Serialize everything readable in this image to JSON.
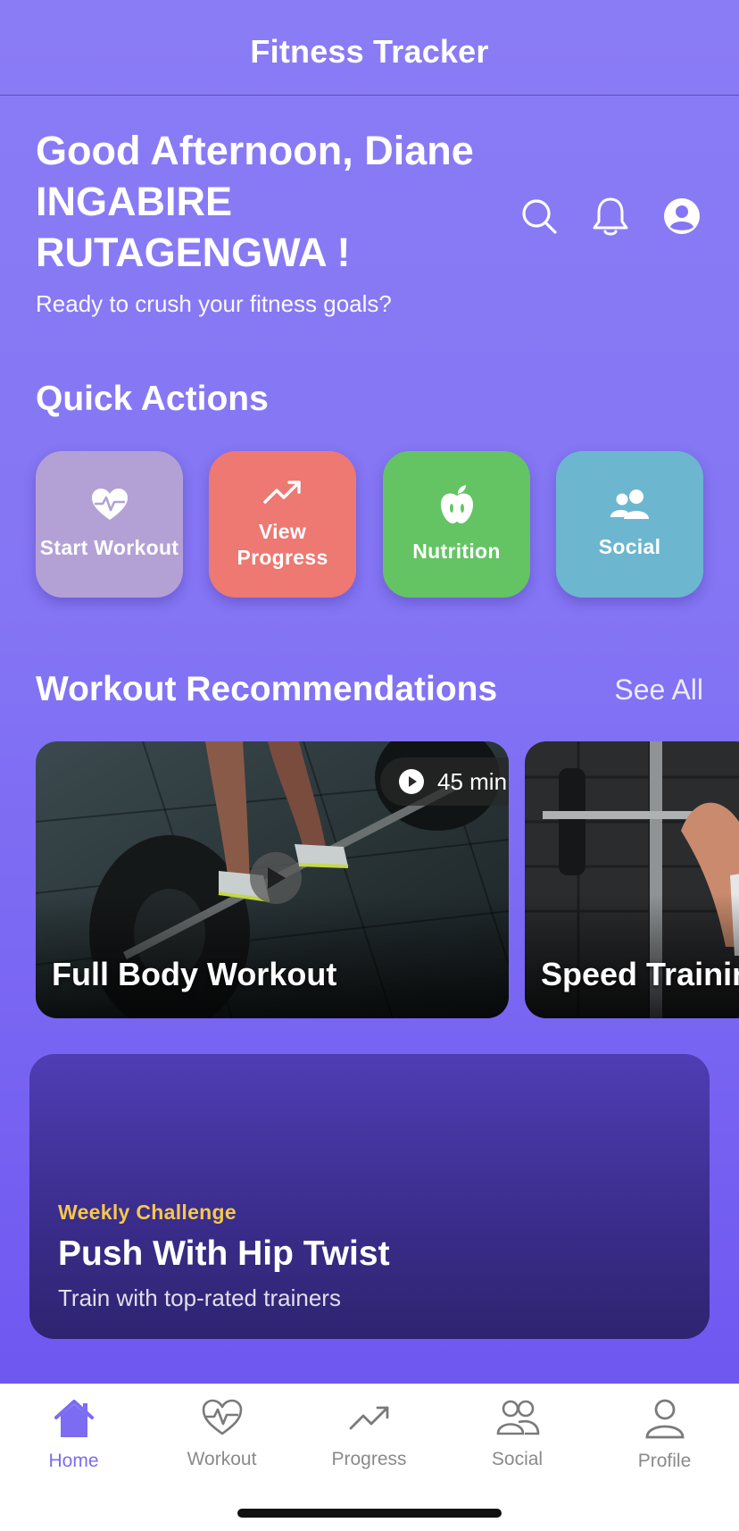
{
  "header": {
    "title": "Fitness Tracker"
  },
  "greeting": {
    "title": "Good Afternoon, Diane INGABIRE RUTAGENGWA !",
    "subtitle": "Ready to crush your fitness goals?"
  },
  "top_icons": [
    "search-icon",
    "bell-icon",
    "account-icon"
  ],
  "quick_actions": {
    "title": "Quick Actions",
    "items": [
      {
        "label": "Start Workout",
        "icon": "heart-pulse-icon",
        "color": "#b3a1d6"
      },
      {
        "label": "View Progress",
        "icon": "trending-up-icon",
        "color": "#ee7872"
      },
      {
        "label": "Nutrition",
        "icon": "apple-icon",
        "color": "#64c464"
      },
      {
        "label": "Social",
        "icon": "people-icon",
        "color": "#6cb7cf"
      }
    ]
  },
  "recommendations": {
    "title": "Workout Recommendations",
    "see_all": "See All",
    "cards": [
      {
        "title": "Full Body Workout",
        "duration": "45 min"
      },
      {
        "title": "Speed Training"
      }
    ]
  },
  "challenge": {
    "kicker": "Weekly Challenge",
    "title": "Push With Hip Twist",
    "subtitle": "Train with top-rated trainers"
  },
  "tabs": [
    {
      "label": "Home",
      "active": true
    },
    {
      "label": "Workout"
    },
    {
      "label": "Progress"
    },
    {
      "label": "Social"
    },
    {
      "label": "Profile"
    }
  ],
  "colors": {
    "accent": "#7b6cf2",
    "challenge_kicker": "#f5c84a"
  }
}
